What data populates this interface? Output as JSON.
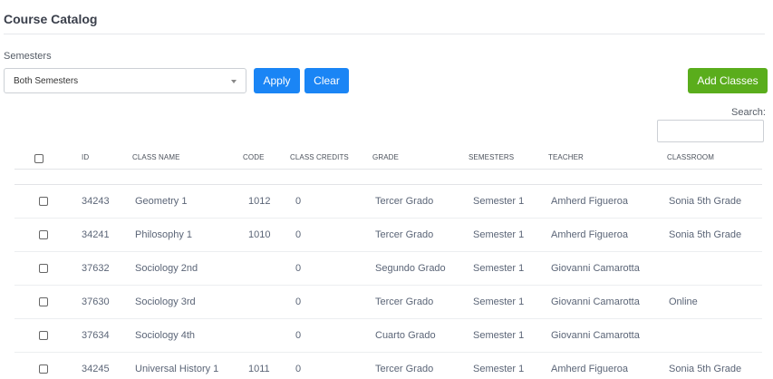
{
  "page": {
    "title": "Course Catalog"
  },
  "filters": {
    "semesters_label": "Semesters",
    "semesters_selected": "Both Semesters",
    "apply_label": "Apply",
    "clear_label": "Clear",
    "add_classes_label": "Add Classes",
    "search_label": "Search:"
  },
  "table": {
    "columns": [
      "ID",
      "Class Name",
      "Code",
      "Class Credits",
      "Grade",
      "Semesters",
      "Teacher",
      "Classroom"
    ],
    "rows": [
      {
        "id": "34243",
        "name": "Geometry 1",
        "code": "1012",
        "credits": "0",
        "grade": "Tercer Grado",
        "semester": "Semester 1",
        "teacher": "Amherd Figueroa",
        "classroom": "Sonia 5th Grade"
      },
      {
        "id": "34241",
        "name": "Philosophy 1",
        "code": "1010",
        "credits": "0",
        "grade": "Tercer Grado",
        "semester": "Semester 1",
        "teacher": "Amherd Figueroa",
        "classroom": "Sonia 5th Grade"
      },
      {
        "id": "37632",
        "name": "Sociology 2nd",
        "code": "",
        "credits": "0",
        "grade": "Segundo Grado",
        "semester": "Semester 1",
        "teacher": "Giovanni Camarotta",
        "classroom": ""
      },
      {
        "id": "37630",
        "name": "Sociology 3rd",
        "code": "",
        "credits": "0",
        "grade": "Tercer Grado",
        "semester": "Semester 1",
        "teacher": "Giovanni Camarotta",
        "classroom": "Online"
      },
      {
        "id": "37634",
        "name": "Sociology 4th",
        "code": "",
        "credits": "0",
        "grade": "Cuarto Grado",
        "semester": "Semester 1",
        "teacher": "Giovanni Camarotta",
        "classroom": ""
      },
      {
        "id": "34245",
        "name": "Universal History 1",
        "code": "1011",
        "credits": "0",
        "grade": "Tercer Grado",
        "semester": "Semester 1",
        "teacher": "Amherd Figueroa",
        "classroom": "Sonia 5th Grade"
      }
    ]
  }
}
